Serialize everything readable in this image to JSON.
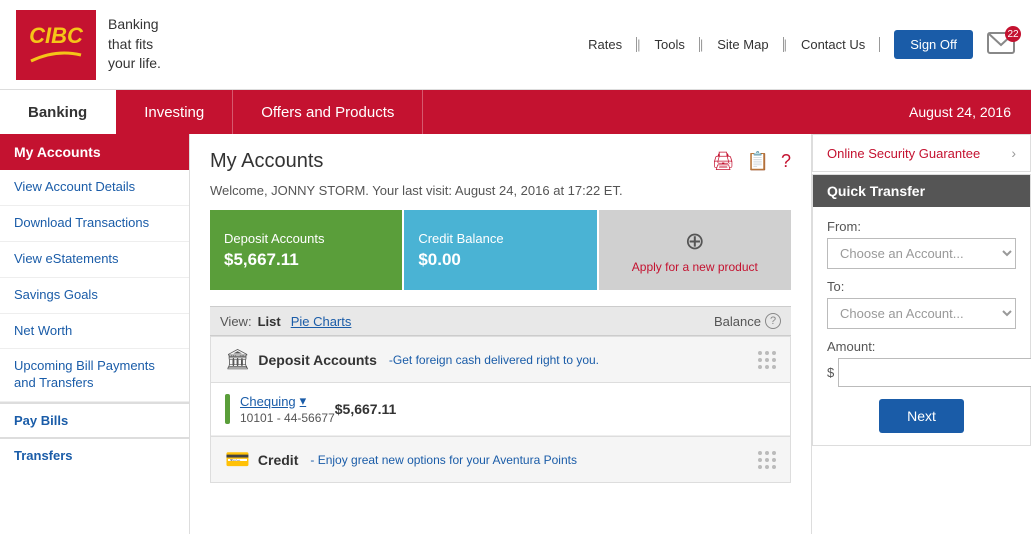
{
  "header": {
    "logo_text": "CIBC",
    "tagline": "Banking\nthat fits\nyour life.",
    "top_links": [
      "Rates",
      "Tools",
      "Site Map",
      "Contact Us"
    ],
    "sign_off": "Sign Off",
    "mail_badge": "22"
  },
  "nav": {
    "tabs": [
      "Banking",
      "Investing",
      "Offers and Products"
    ],
    "active_tab": "Banking",
    "date": "August 24, 2016"
  },
  "sidebar": {
    "header": "My Accounts",
    "items": [
      "View Account Details",
      "Download Transactions",
      "View eStatements",
      "Savings Goals",
      "Net Worth",
      "Upcoming Bill Payments and Transfers"
    ],
    "sections": [
      "Pay Bills",
      "Transfers"
    ]
  },
  "content": {
    "title": "My Accounts",
    "welcome": "Welcome, JONNY STORM. Your last visit: August 24, 2016 at 17:22 ET.",
    "summary": {
      "deposit_label": "Deposit Accounts",
      "deposit_amount": "$5,667.11",
      "credit_label": "Credit Balance",
      "credit_amount": "$0.00",
      "apply_icon": "⊕",
      "apply_text": "Apply for a new product"
    },
    "view_bar": {
      "label": "View:",
      "list_link": "List",
      "pie_link": "Pie Charts",
      "balance_label": "Balance"
    },
    "deposit_section": {
      "icon": "🏛",
      "title": "Deposit Accounts",
      "promo": "-Get foreign cash delivered right to you.",
      "accounts": [
        {
          "name": "Chequing",
          "dropdown": "▾",
          "number": "10101 - 44-56677",
          "balance": "$5,667.11"
        }
      ]
    },
    "credit_section": {
      "icon": "💳",
      "title": "Credit",
      "promo": "- Enjoy great new options for your Aventura Points"
    }
  },
  "right_panel": {
    "security_text": "Online Security Guarantee",
    "quick_transfer_header": "Quick Transfer",
    "from_label": "From:",
    "from_placeholder": "Choose an Account...",
    "to_label": "To:",
    "to_placeholder": "Choose an Account...",
    "amount_label": "Amount:",
    "dollar_sign": "$",
    "next_btn": "Next"
  }
}
